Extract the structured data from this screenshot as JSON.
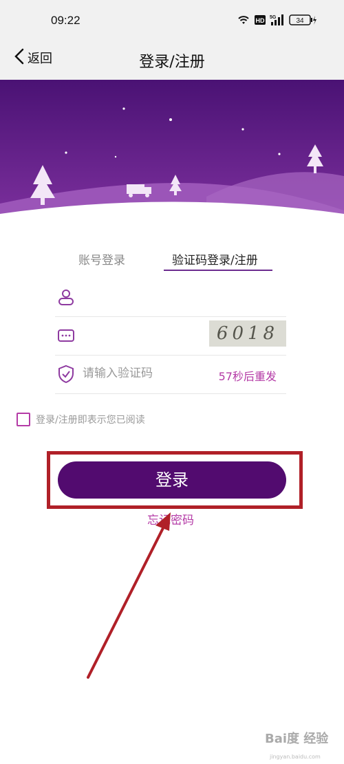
{
  "status_bar": {
    "time": "09:22",
    "hd": "HD",
    "network": "5G",
    "battery": "34"
  },
  "nav": {
    "back_label": "返回",
    "title": "登录/注册"
  },
  "tabs": [
    {
      "label": "账号登录",
      "active": false
    },
    {
      "label": "验证码登录/注册",
      "active": true
    }
  ],
  "form": {
    "username_placeholder": "",
    "password_placeholder": "",
    "captcha_text": "6018",
    "code_placeholder": "请输入验证码",
    "resend_label": "57秒后重发"
  },
  "agreement_text": "登录/注册即表示您已阅读",
  "login_button": "登录",
  "forgot_link": "忘记密码",
  "colors": {
    "primary": "#520b6f",
    "accent": "#b43aa6",
    "highlight": "#b02028",
    "banner": "#5a1a86"
  },
  "watermark": {
    "text": "Bai度 经验",
    "url": "jingyan.baidu.com"
  }
}
